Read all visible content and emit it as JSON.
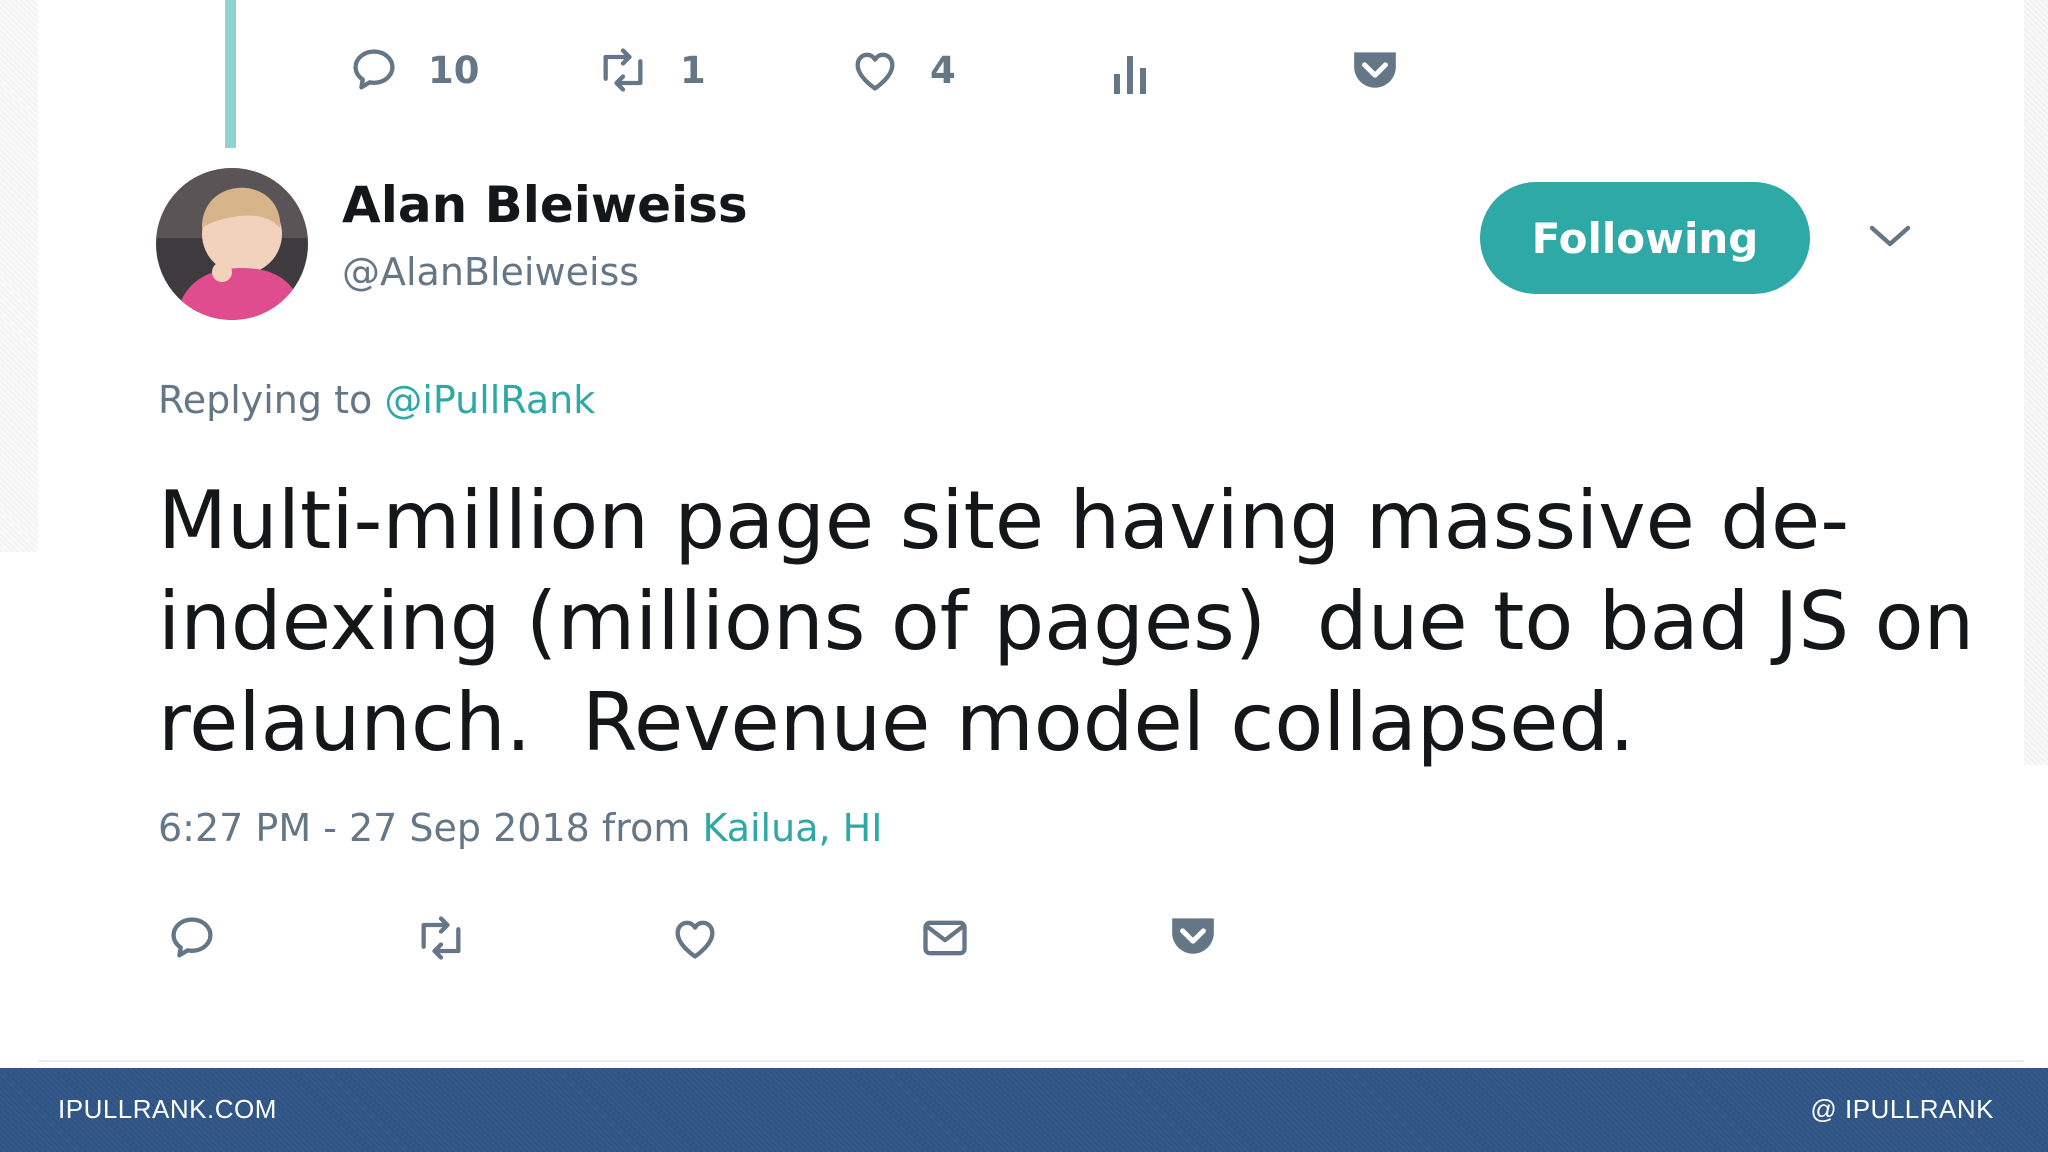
{
  "previous_tweet_actions": {
    "reply_count": "10",
    "retweet_count": "1",
    "like_count": "4"
  },
  "tweet": {
    "display_name": "Alan Bleiweiss",
    "handle": "@AlanBleiweiss",
    "follow_button_label": "Following",
    "replying_prefix": "Replying to",
    "replying_mention": "@iPullRank",
    "text_lines": [
      "Multi-million page site having massive de-",
      "indexing (millions of pages)  due to bad JS on",
      "relaunch.  Revenue model collapsed."
    ],
    "timestamp": "6:27 PM - 27 Sep 2018",
    "from_word": "from",
    "location": "Kailua, HI"
  },
  "footer": {
    "left": "IPULLRANK.COM",
    "right": "@ IPULLRANK"
  },
  "colors": {
    "accent": "#2fa9a5",
    "muted_text": "#657786",
    "thread_line": "#8fd3cf",
    "footer_bg": "#325785"
  },
  "icons": {
    "top_row": [
      "reply-icon",
      "retweet-icon",
      "like-icon",
      "analytics-icon",
      "pocket-icon"
    ],
    "bottom_row": [
      "reply-icon",
      "retweet-icon",
      "like-icon",
      "direct-message-icon",
      "pocket-icon"
    ]
  }
}
